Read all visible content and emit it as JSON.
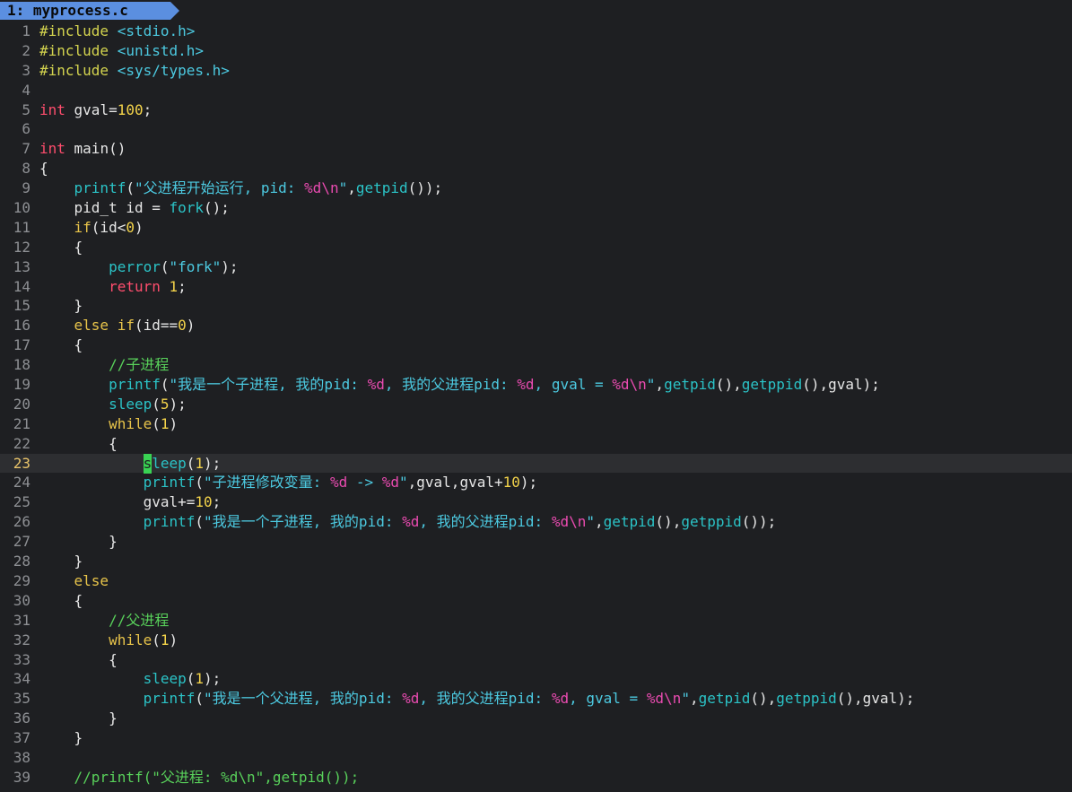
{
  "tab": {
    "label": "1: myprocess.c"
  },
  "editor": {
    "current_line": 23,
    "lines": [
      {
        "num": "1",
        "text": "#include <stdio.h>"
      },
      {
        "num": "2",
        "text": "#include <unistd.h>"
      },
      {
        "num": "3",
        "text": "#include <sys/types.h>"
      },
      {
        "num": "4",
        "text": ""
      },
      {
        "num": "5",
        "text": "int gval=100;"
      },
      {
        "num": "6",
        "text": ""
      },
      {
        "num": "7",
        "text": "int main()"
      },
      {
        "num": "8",
        "text": "{"
      },
      {
        "num": "9",
        "text": "    printf(\"父进程开始运行, pid: %d\\n\",getpid());"
      },
      {
        "num": "10",
        "text": "    pid_t id = fork();"
      },
      {
        "num": "11",
        "text": "    if(id<0)"
      },
      {
        "num": "12",
        "text": "    {"
      },
      {
        "num": "13",
        "text": "        perror(\"fork\");"
      },
      {
        "num": "14",
        "text": "        return 1;"
      },
      {
        "num": "15",
        "text": "    }"
      },
      {
        "num": "16",
        "text": "    else if(id==0)"
      },
      {
        "num": "17",
        "text": "    {"
      },
      {
        "num": "18",
        "text": "        //子进程"
      },
      {
        "num": "19",
        "text": "        printf(\"我是一个子进程, 我的pid: %d, 我的父进程pid: %d, gval = %d\\n\",getpid(),getppid(),gval);"
      },
      {
        "num": "20",
        "text": "        sleep(5);"
      },
      {
        "num": "21",
        "text": "        while(1)"
      },
      {
        "num": "22",
        "text": "        {"
      },
      {
        "num": "23",
        "text": "            sleep(1);"
      },
      {
        "num": "24",
        "text": "            printf(\"子进程修改变量: %d -> %d\",gval,gval+10);"
      },
      {
        "num": "25",
        "text": "            gval+=10;"
      },
      {
        "num": "26",
        "text": "            printf(\"我是一个子进程, 我的pid: %d, 我的父进程pid: %d\\n\",getpid(),getppid());"
      },
      {
        "num": "27",
        "text": "        }"
      },
      {
        "num": "28",
        "text": "    }"
      },
      {
        "num": "29",
        "text": "    else"
      },
      {
        "num": "30",
        "text": "    {"
      },
      {
        "num": "31",
        "text": "        //父进程"
      },
      {
        "num": "32",
        "text": "        while(1)"
      },
      {
        "num": "33",
        "text": "        {"
      },
      {
        "num": "34",
        "text": "            sleep(1);"
      },
      {
        "num": "35",
        "text": "            printf(\"我是一个父进程, 我的pid: %d, 我的父进程pid: %d, gval = %d\\n\",getpid(),getppid(),gval);"
      },
      {
        "num": "36",
        "text": "        }"
      },
      {
        "num": "37",
        "text": "    }"
      },
      {
        "num": "38",
        "text": ""
      },
      {
        "num": "39",
        "text": "    //printf(\"父进程: %d\\n\",getpid());"
      }
    ]
  },
  "colors": {
    "background": "#1e1f22",
    "tab_background": "#5b8fe0",
    "line_number": "#8d8f93",
    "current_line_number": "#e9c46a",
    "cursor": "#39d353",
    "preprocessor": "#d4d44f",
    "include_path": "#4cc9e0",
    "type_keyword": "#ff4d6d",
    "number": "#f3d34a",
    "function": "#2bc3c7",
    "control_keyword": "#e8c44a",
    "format_specifier": "#e94bb0",
    "comment": "#58d05a"
  }
}
